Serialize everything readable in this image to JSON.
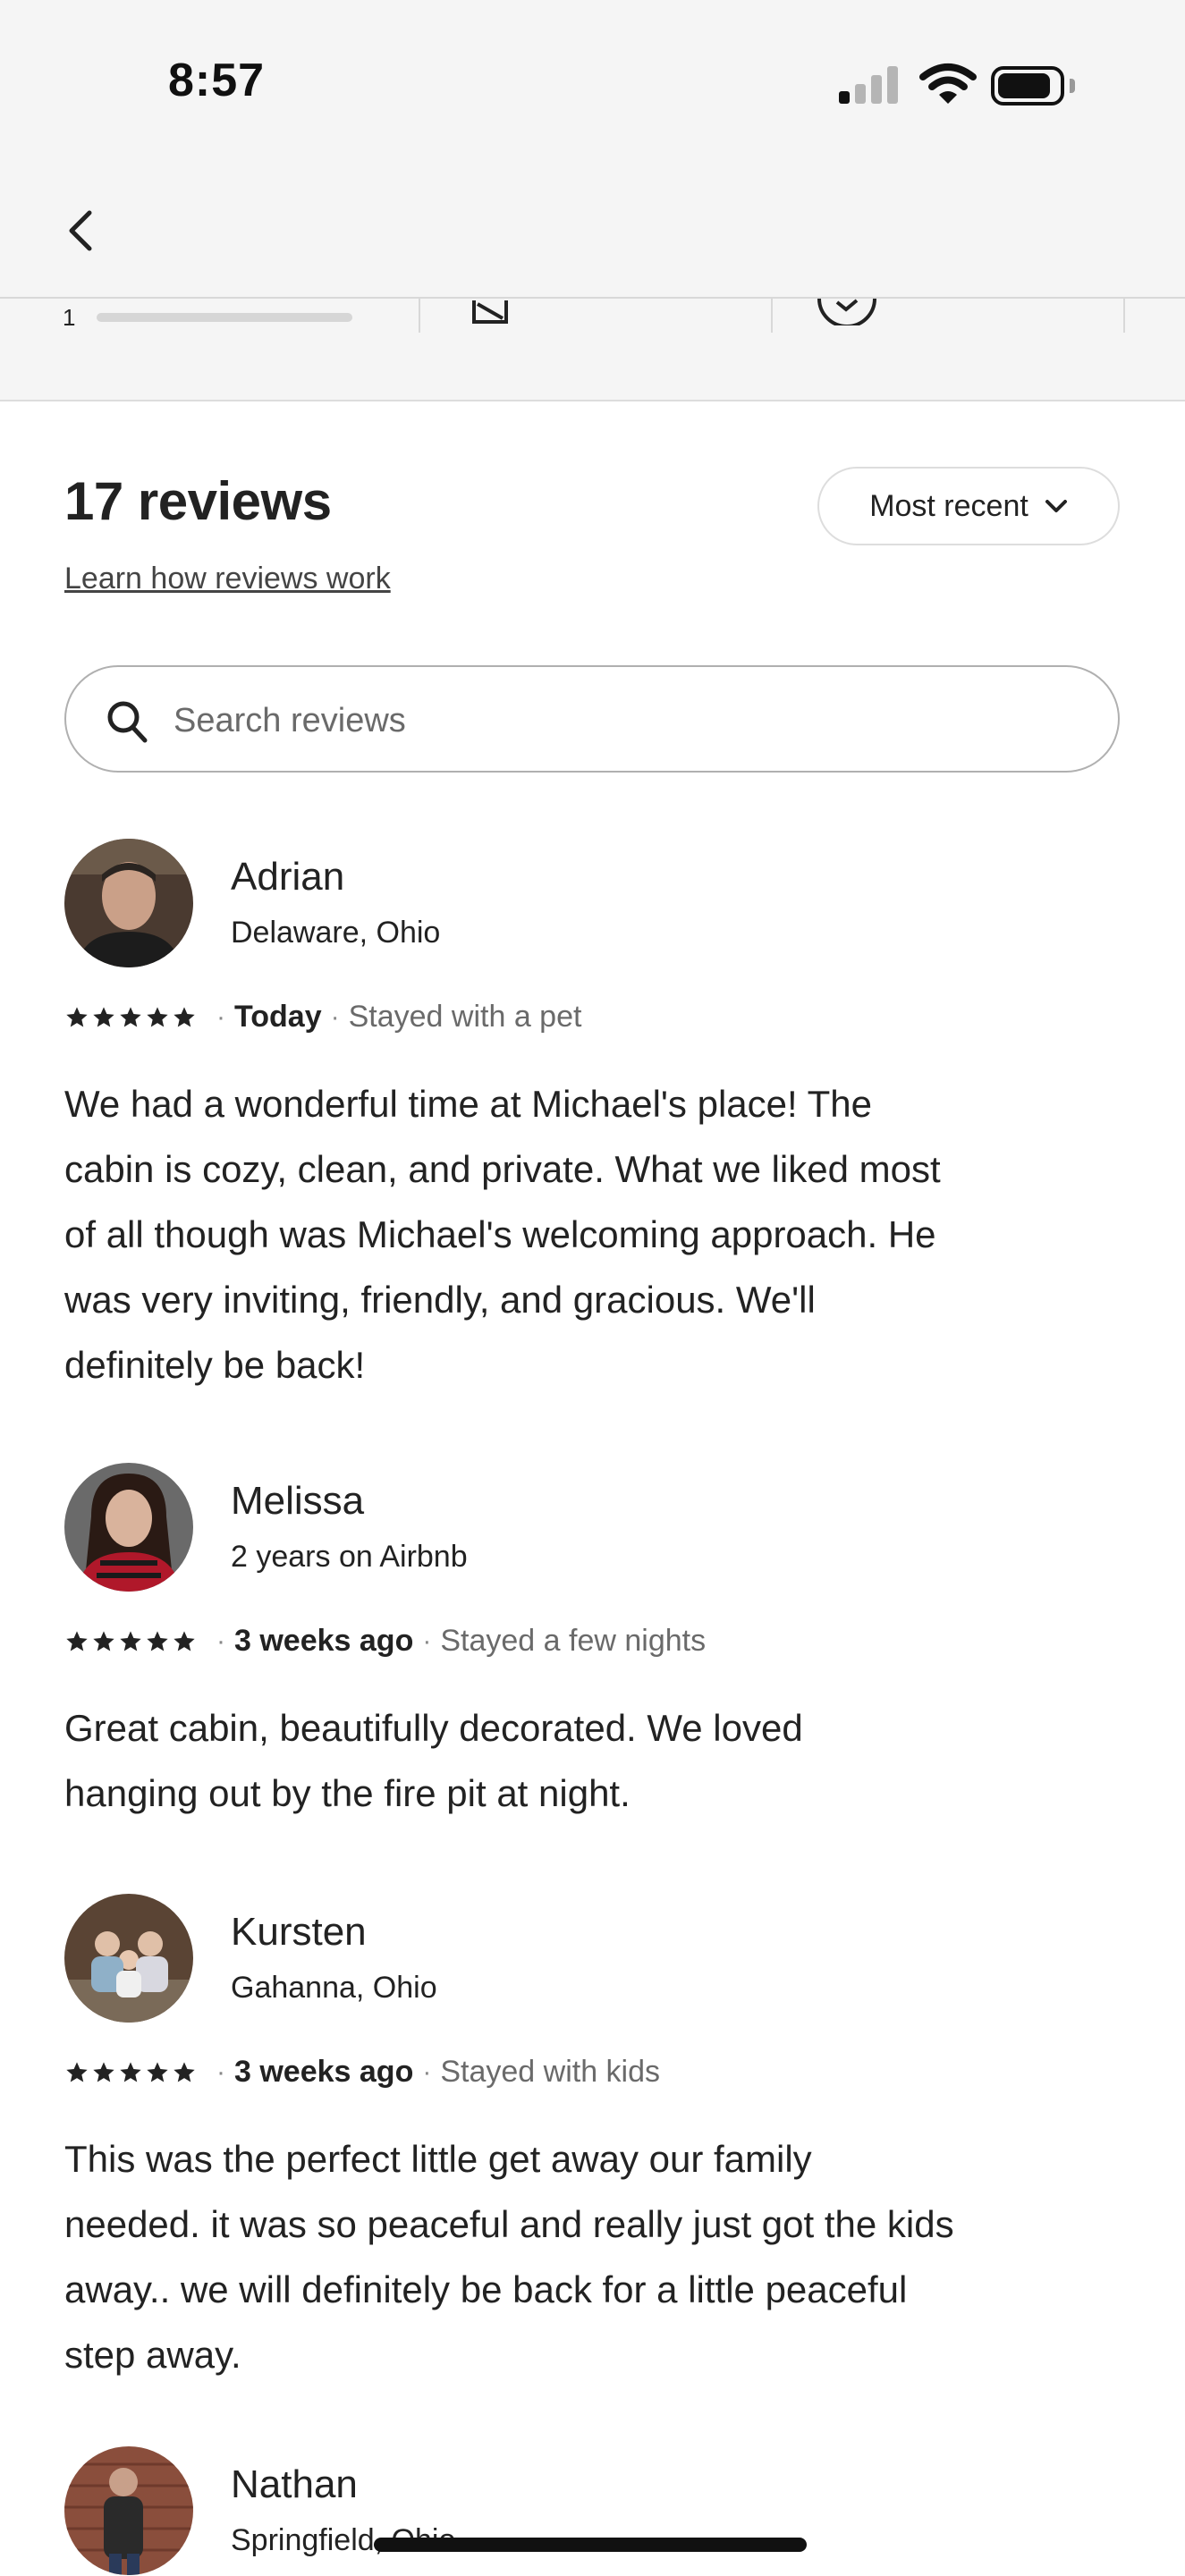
{
  "status_bar": {
    "time": "8:57"
  },
  "nav": {
    "strip_number": "1"
  },
  "reviews_header": {
    "count_label": "17 reviews",
    "learn_link": "Learn how reviews work",
    "sort_label": "Most recent"
  },
  "search": {
    "placeholder": "Search reviews",
    "value": ""
  },
  "reviews": [
    {
      "name": "Adrian",
      "subtitle": "Delaware, Ohio",
      "rating": 5,
      "date": "Today",
      "stay": "Stayed with a pet",
      "text": "We had a wonderful time at Michael's place!  The\ncabin is cozy, clean, and private.  What we liked most\nof all though was Michael's welcoming approach.  He\nwas very inviting, friendly, and gracious. We'll\ndefinitely  be back!"
    },
    {
      "name": "Melissa",
      "subtitle": "2 years on Airbnb",
      "rating": 5,
      "date": "3 weeks ago",
      "stay": "Stayed a few nights",
      "text": "Great cabin, beautifully decorated. We loved\nhanging out by the fire pit at night."
    },
    {
      "name": "Kursten",
      "subtitle": "Gahanna, Ohio",
      "rating": 5,
      "date": "3 weeks ago",
      "stay": "Stayed with kids",
      "text": "This was the perfect little get away our family\nneeded. it was so peaceful and really just got the kids\naway.. we will definitely be back for a little peaceful\nstep away."
    },
    {
      "name": "Nathan",
      "subtitle": "Springfield, Ohio"
    }
  ],
  "colors": {
    "text": "#222222",
    "muted": "#6a6a6a",
    "border": "#dddddd",
    "star": "#222222",
    "header_bg": "#f5f5f5"
  }
}
